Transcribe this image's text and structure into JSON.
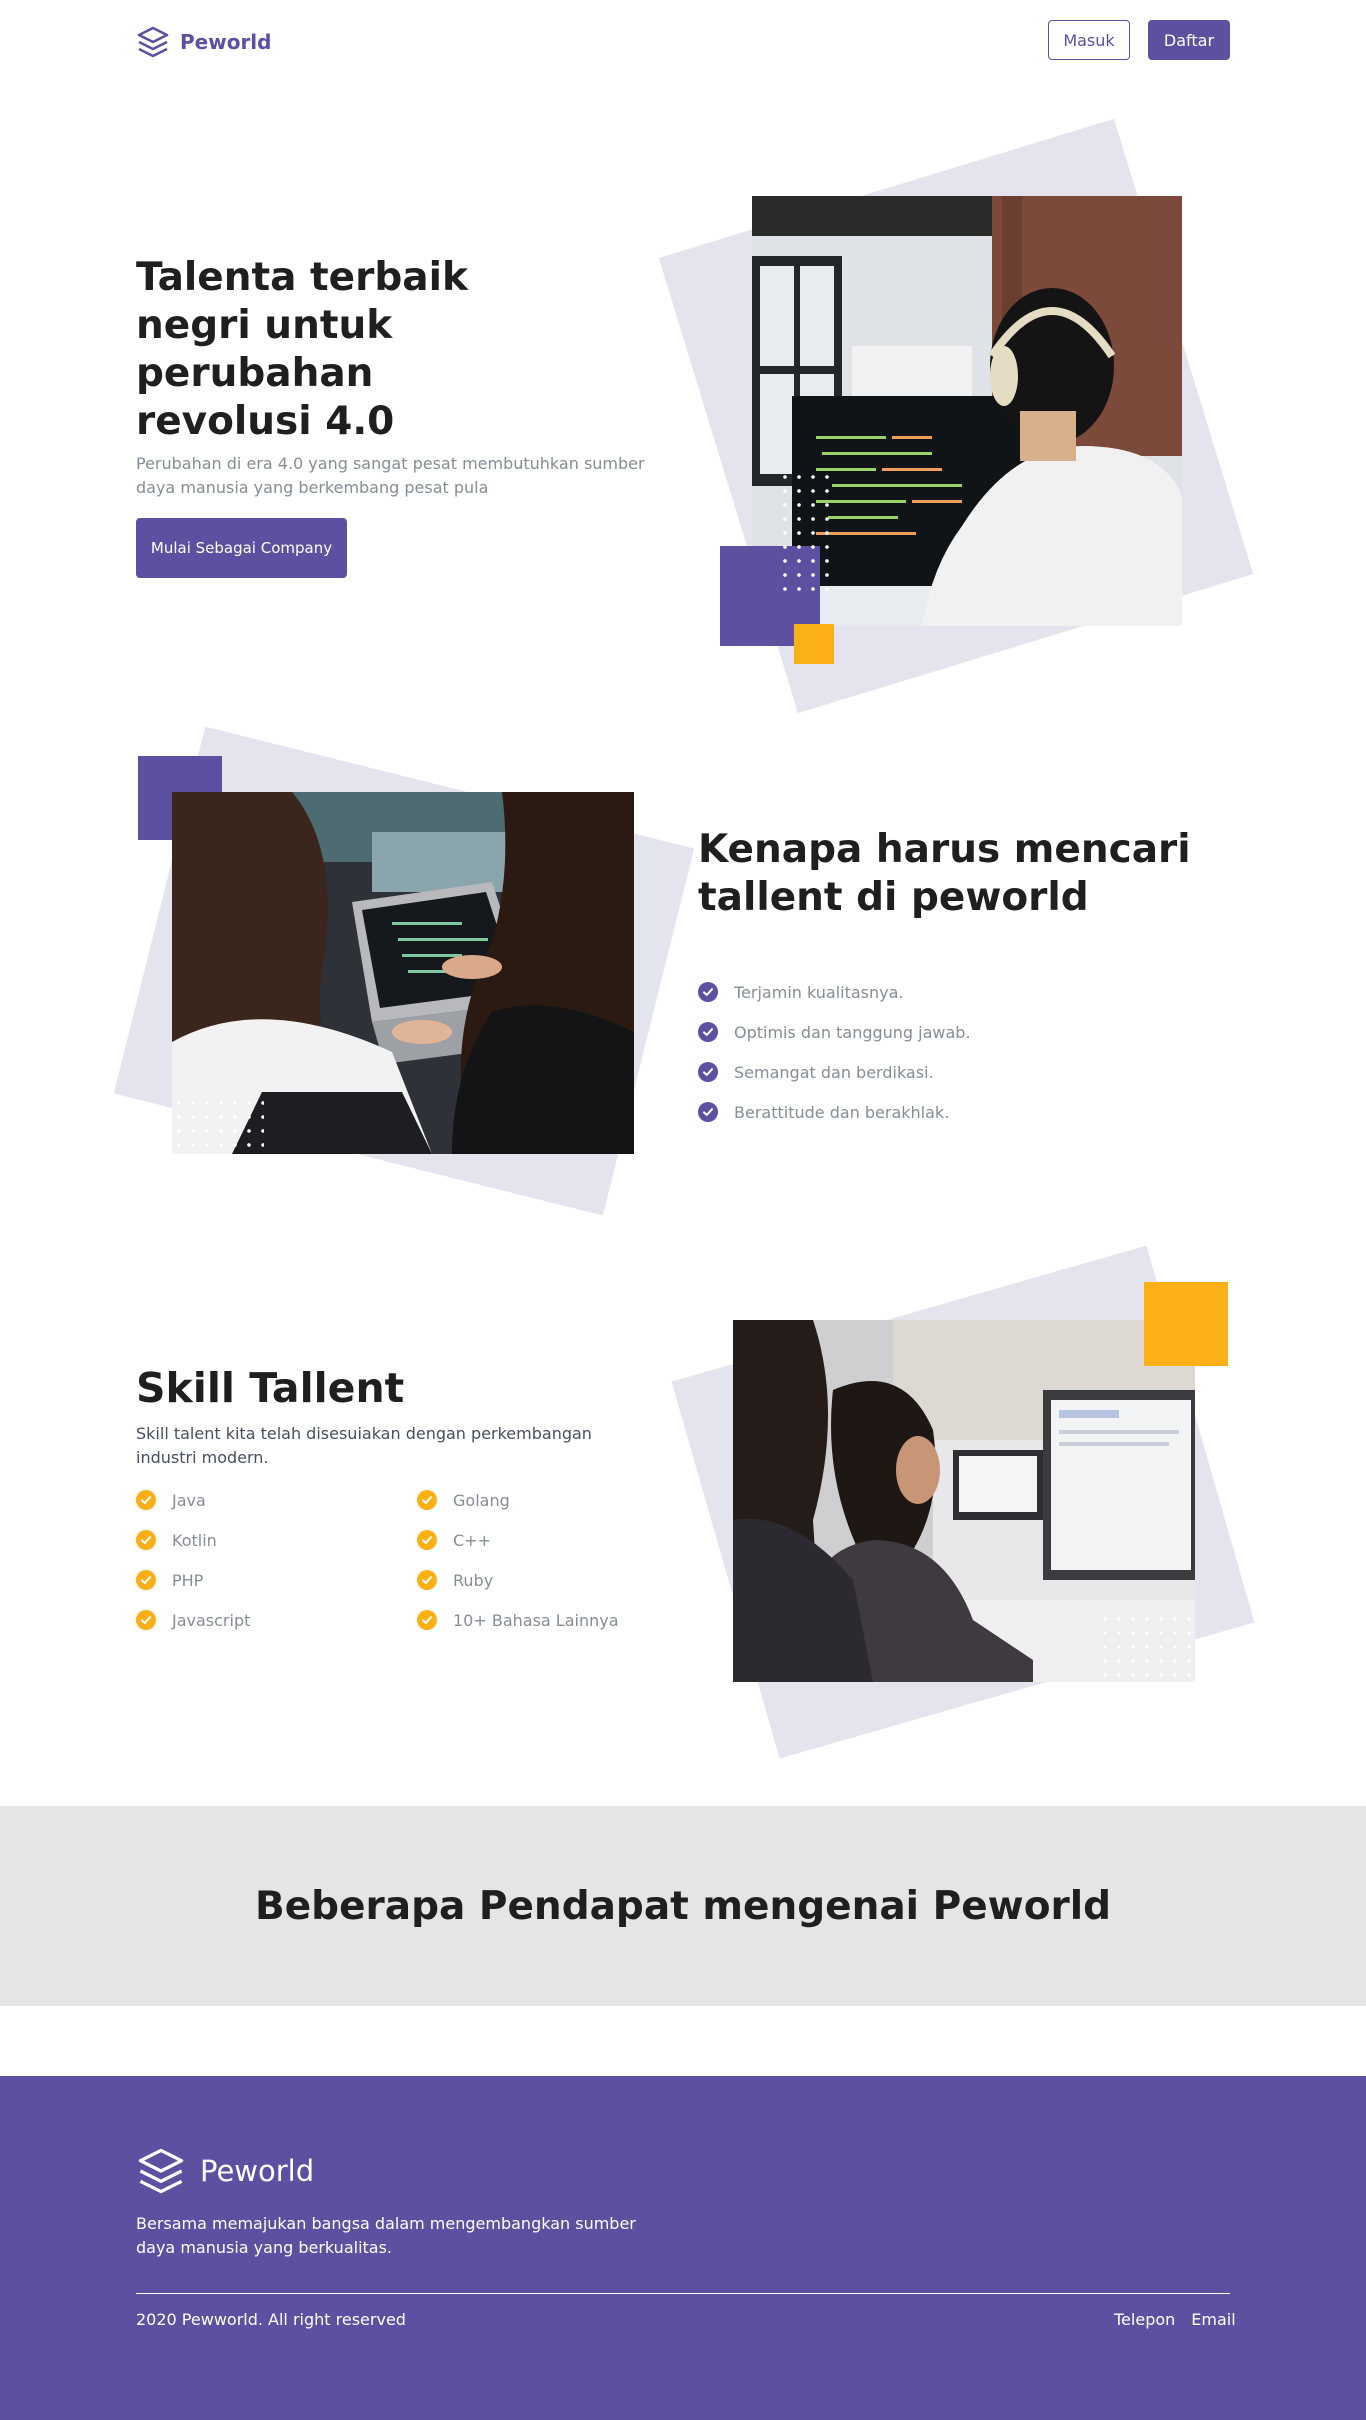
{
  "nav": {
    "brand": "Peworld",
    "login_label": "Masuk",
    "register_label": "Daftar"
  },
  "hero": {
    "title": "Talenta terbaik negri untuk perubahan revolusi 4.0",
    "subtitle": "Perubahan di era 4.0 yang sangat pesat membutuhkan sumber daya manusia yang berkembang pesat pula",
    "cta_label": "Mulai Sebagai Company"
  },
  "why": {
    "title": "Kenapa harus mencari tallent di peworld",
    "items": [
      "Terjamin kualitasnya.",
      "Optimis dan tanggung jawab.",
      "Semangat dan berdikasi.",
      "Berattitude dan berakhlak."
    ]
  },
  "skill": {
    "title": "Skill Tallent",
    "subtitle": "Skill talent kita telah disesuiakan dengan perkembangan industri modern.",
    "items": [
      "Java",
      "Golang",
      "Kotlin",
      "C++",
      "PHP",
      "Ruby",
      "Javascript",
      "10+ Bahasa Lainnya"
    ]
  },
  "testimonial": {
    "title": "Beberapa Pendapat mengenai Peworld"
  },
  "footer": {
    "brand": "Peworld",
    "description": "Bersama memajukan bangsa dalam mengembangkan sumber daya manusia yang berkualitas.",
    "copyright": "2020 Pewworld. All right reserved",
    "links": [
      "Telepon",
      "Email"
    ]
  },
  "colors": {
    "brand": "#5e50a1",
    "accent": "#fbb017",
    "muted_text": "#858d96",
    "band": "#e5e5e5"
  }
}
